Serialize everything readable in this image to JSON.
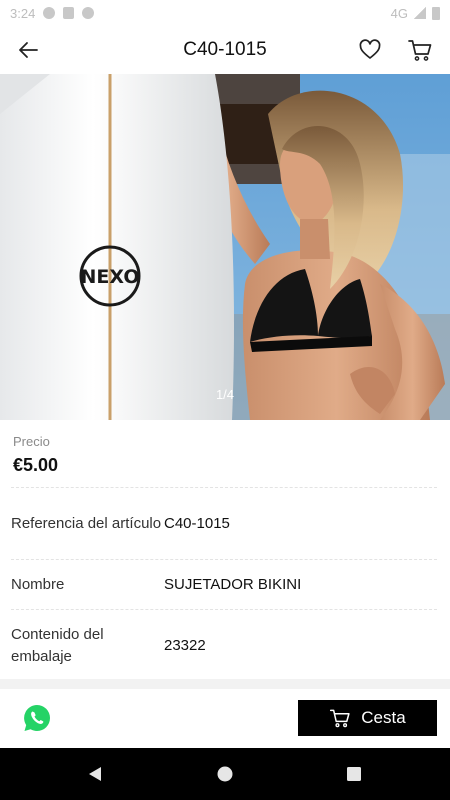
{
  "status_bar": {
    "time": "3:24",
    "network": "4G"
  },
  "header": {
    "title": "C40-1015",
    "back_icon": "arrow-left-icon",
    "favorite_icon": "heart-icon",
    "cart_icon": "cart-icon"
  },
  "gallery": {
    "page_indicator": "1/4",
    "logo_text": "NEXO"
  },
  "price": {
    "label": "Precio",
    "value": "€5.00"
  },
  "details": [
    {
      "label": "Referencia del artículo",
      "value": "C40-1015"
    },
    {
      "label": "Nombre",
      "value": "SUJETADOR BIKINI"
    },
    {
      "label": "Contenido del embalaje",
      "value": "23322"
    }
  ],
  "actions": {
    "whatsapp_icon": "whatsapp-icon",
    "basket_label": "Cesta",
    "basket_icon": "cart-icon"
  },
  "colors": {
    "accent": "#000000",
    "whatsapp": "#25D366",
    "sky": "#6aa6d8"
  }
}
